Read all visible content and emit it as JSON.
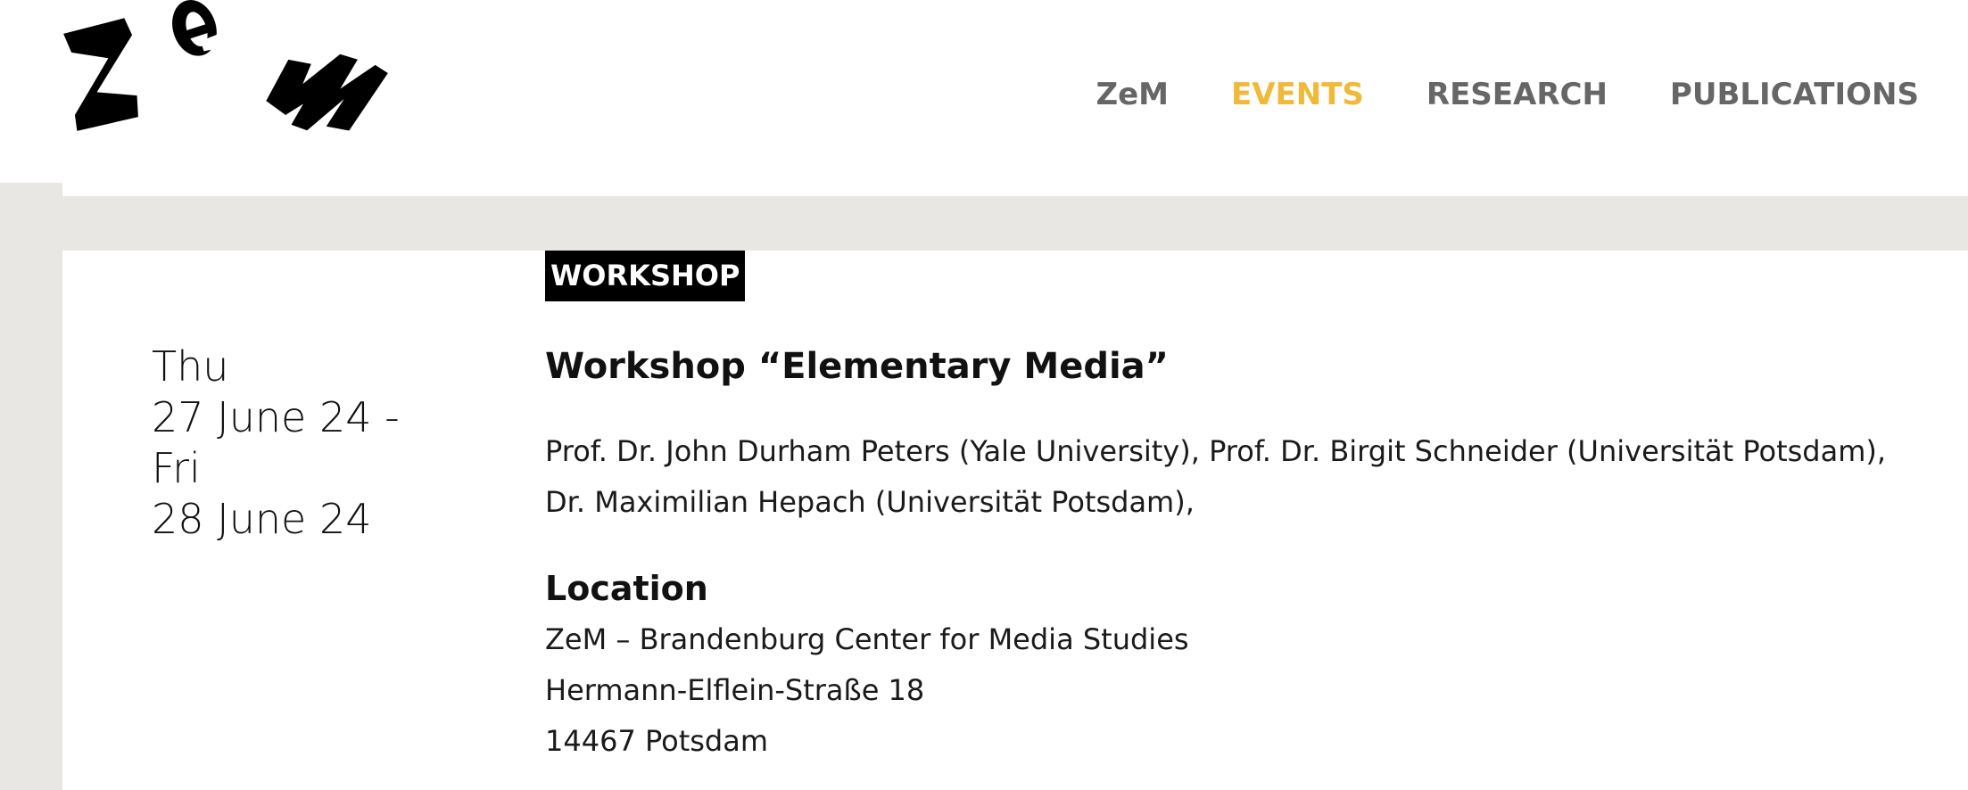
{
  "header": {
    "logo_text": "ZeM",
    "nav": [
      {
        "label": "ZeM",
        "active": false
      },
      {
        "label": "EVENTS",
        "active": true
      },
      {
        "label": "RESEARCH",
        "active": false
      },
      {
        "label": "PUBLICATIONS",
        "active": false
      }
    ]
  },
  "event": {
    "category": "WORKSHOP",
    "date_lines": [
      "Thu",
      "27 June 24 -",
      "Fri",
      "28 June 24"
    ],
    "title": "Workshop “Elementary Media”",
    "speakers": "Prof. Dr. John Durham Peters (Yale University), Prof. Dr. Birgit Schneider (Universität Potsdam), Dr. Maximilian Hepach (Universität Potsdam),",
    "location": {
      "heading": "Location",
      "lines": [
        "ZeM – Brandenburg Center for Media Studies",
        "Hermann-Elflein-Straße 18",
        "14467 Potsdam"
      ]
    }
  },
  "colors": {
    "nav_active": "#f0b93a",
    "nav_default": "#666666",
    "frame_grey": "#e8e7e3",
    "badge_bg": "#000000"
  }
}
